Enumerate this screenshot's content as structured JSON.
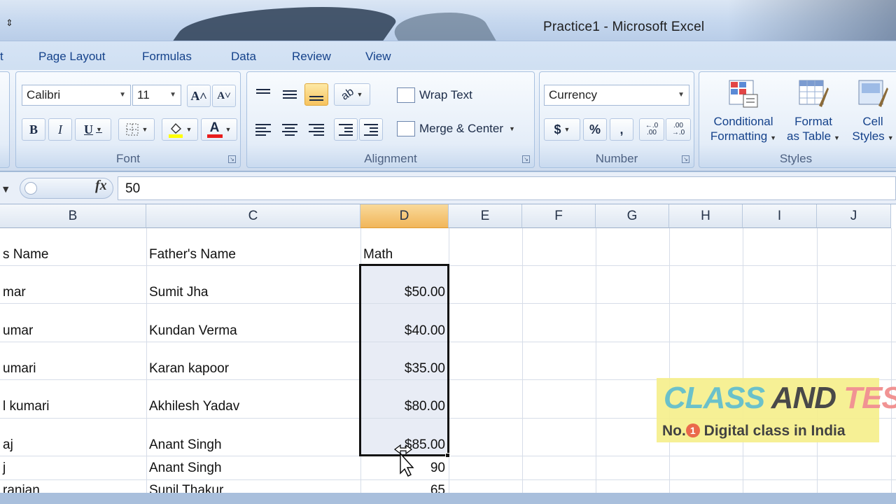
{
  "window": {
    "title": "Practice1 - Microsoft Excel",
    "qat_glyph": "⇕"
  },
  "tabs": [
    {
      "label": "t"
    },
    {
      "label": "Page Layout"
    },
    {
      "label": "Formulas"
    },
    {
      "label": "Data"
    },
    {
      "label": "Review"
    },
    {
      "label": "View"
    }
  ],
  "font_group": {
    "label": "Font",
    "font_name": "Calibri",
    "font_size": "11",
    "grow_font": "A˄",
    "shrink_font": "A˅",
    "bold": "B",
    "italic": "I",
    "underline": "U",
    "font_color_letter": "A",
    "fill_color": "#ffff00",
    "font_color": "#e81c1c"
  },
  "alignment_group": {
    "label": "Alignment",
    "wrap_text": "Wrap Text",
    "merge_center": "Merge & Center"
  },
  "number_group": {
    "label": "Number",
    "format": "Currency",
    "dollar": "$",
    "percent": "%",
    "comma": ",",
    "inc_decimal": "←.0 .00",
    "dec_decimal": ".00 →.0"
  },
  "styles_group": {
    "label": "Styles",
    "conditional_1": "Conditional",
    "conditional_2": "Formatting",
    "format_table_1": "Format",
    "format_table_2": "as Table",
    "cell_styles_1": "Cell",
    "cell_styles_2": "Styles"
  },
  "formula_bar": {
    "fx": "fx",
    "value": "50"
  },
  "columns": [
    "B",
    "C",
    "D",
    "E",
    "F",
    "G",
    "H",
    "I",
    "J"
  ],
  "selected_column": "D",
  "rows": [
    {
      "b": "s Name",
      "c": "Father's Name",
      "d": "Math"
    },
    {
      "b": "mar",
      "c": "Sumit Jha",
      "d": "$50.00"
    },
    {
      "b": "umar",
      "c": "Kundan Verma",
      "d": "$40.00"
    },
    {
      "b": "umari",
      "c": "Karan kapoor",
      "d": "$35.00"
    },
    {
      "b": "l kumari",
      "c": "Akhilesh Yadav",
      "d": "$80.00"
    },
    {
      "b": "aj",
      "c": "Anant Singh",
      "d": "$85.00"
    },
    {
      "b": "j",
      "c": "Anant Singh",
      "d": "90"
    },
    {
      "b": "ranjan",
      "c": "Sunil Thakur",
      "d": "65"
    }
  ],
  "watermark": {
    "brand_a": "CLASS",
    "brand_b": " AND",
    "brand_c": " TEST",
    "tag_pre": "No.",
    "tag_num": "1",
    "tag_post": " Digital class in India"
  },
  "colors": {
    "selection_header": "#f1b65a",
    "ribbon_text": "#15428b"
  }
}
